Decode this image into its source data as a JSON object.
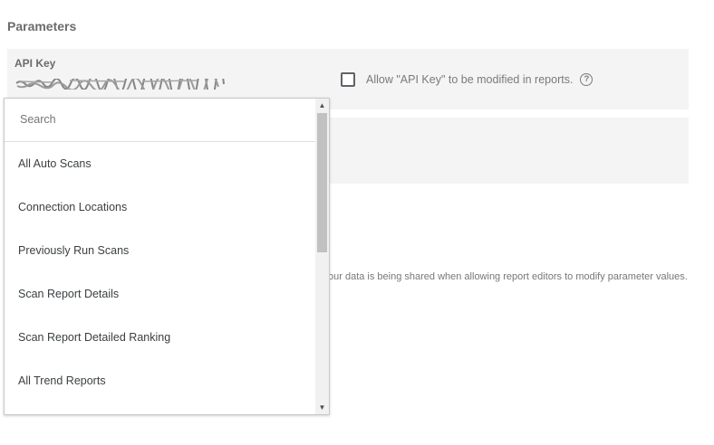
{
  "section": {
    "title": "Parameters"
  },
  "parameters": [
    {
      "label": "API Key",
      "allow_modify_text": "Allow \"API Key\" to be modified in reports.",
      "allow_checked": false
    }
  ],
  "hint_text": "our data is being shared when allowing report editors to modify parameter values.",
  "dropdown": {
    "search_placeholder": "Search",
    "items": [
      "All Auto Scans",
      "Connection Locations",
      "Previously Run Scans",
      "Scan Report Details",
      "Scan Report Detailed Ranking",
      "All Trend Reports"
    ],
    "scroll_position": 0
  },
  "icons": {
    "help": "help-circle-icon",
    "scroll_up": "arrow-up-icon",
    "scroll_down": "arrow-down-icon"
  },
  "colors": {
    "row_background": "#f4f4f4",
    "text": "#5f6368"
  }
}
